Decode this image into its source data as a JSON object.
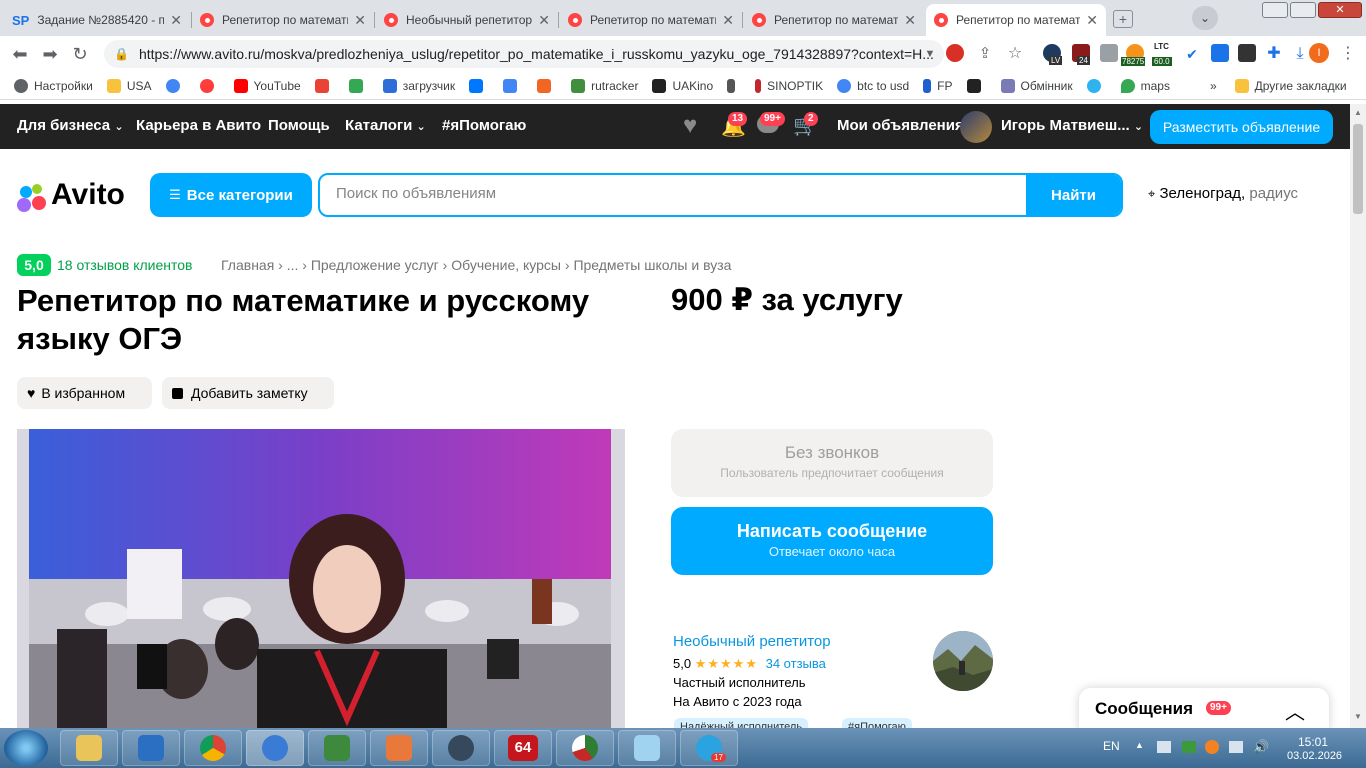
{
  "browser": {
    "tabs": [
      {
        "title": "Задание №2885420 - п",
        "favicon": "sp-icon"
      },
      {
        "title": "Репетитор по математи",
        "favicon": "avito-icon"
      },
      {
        "title": "Необычный репетитор",
        "favicon": "avito-icon"
      },
      {
        "title": "Репетитор по математи",
        "favicon": "avito-icon"
      },
      {
        "title": "Репетитор по математи",
        "favicon": "avito-icon"
      },
      {
        "title": "Репетитор по математи",
        "favicon": "avito-icon"
      }
    ],
    "sp_label": "SP",
    "url": "https://www.avito.ru/moskva/predlozheniya_uslug/repetitor_po_matematike_i_russkomu_yazyku_oge_7914328897?context=H...",
    "extension_labels": {
      "lv": "LV",
      "n24": "24",
      "btc": "78275",
      "ltc_top": "LTC",
      "ltc": "60.0",
      "profile": "I"
    },
    "bookmarks": [
      {
        "label": "Настройки",
        "color": "#5f6368"
      },
      {
        "label": "USA",
        "color": "#f9c23c"
      },
      {
        "label": "",
        "color": "#4285f4"
      },
      {
        "label": "",
        "color": "#ff3d3d"
      },
      {
        "label": "YouTube",
        "color": "#ff0000"
      },
      {
        "label": "",
        "color": "#ea4335"
      },
      {
        "label": "",
        "color": "#34a853"
      },
      {
        "label": "загрузчик",
        "color": "#2f6ed8"
      },
      {
        "label": "",
        "color": "#0077ff"
      },
      {
        "label": "",
        "color": "#4285f4"
      },
      {
        "label": "",
        "color": "#f26522"
      },
      {
        "label": "rutracker",
        "color": "#3f8f3f"
      },
      {
        "label": "UAKino",
        "color": "#222222"
      },
      {
        "label": "",
        "color": "#555555"
      },
      {
        "label": "SINOPTIK",
        "color": "#c1272d"
      },
      {
        "label": "btc to usd",
        "color": "#4285f4"
      },
      {
        "label": "FP",
        "color": "#1f5fcf"
      },
      {
        "label": "",
        "color": "#222222"
      },
      {
        "label": "Обмінник",
        "color": "#7a7ab5"
      },
      {
        "label": "",
        "color": "#2db4f0"
      },
      {
        "label": "maps",
        "color": "#34a853"
      }
    ],
    "bookmarks_more": "»",
    "other_bookmarks": "Другие закладки"
  },
  "header": {
    "nav": [
      "Для бизнеса",
      "Карьера в Авито",
      "Помощь",
      "Каталоги",
      "#яПомогаю"
    ],
    "notif_badge": "13",
    "msg_badge": "99+",
    "cart_badge": "2",
    "my_ads": "Мои объявления",
    "user_name": "Игорь Матвиеш...",
    "post_button": "Разместить объявление"
  },
  "search": {
    "logo_text": "Avito",
    "all_categories": "Все категории",
    "placeholder": "Поиск по объявлениям",
    "find_button": "Найти",
    "location_city": "Зеленоград,",
    "location_radius": "радиус"
  },
  "listing": {
    "rating": "5,0",
    "reviews": "18 отзывов клиентов",
    "breadcrumb": "Главная › ... › Предложение услуг › Обучение, курсы › Предметы школы и вуза",
    "title": "Репетитор по математике и русскому языку ОГЭ",
    "price": "900 ₽ за услугу",
    "favorite": "В избранном",
    "add_note": "Добавить заметку"
  },
  "contact": {
    "no_calls_title": "Без звонков",
    "no_calls_sub": "Пользователь предпочитает сообщения",
    "write_title": "Написать сообщение",
    "write_sub": "Отвечает около часа"
  },
  "seller": {
    "name": "Необычный репетитор",
    "rating": "5,0",
    "stars": "★★★★★",
    "reviews": "34 отзыва",
    "type": "Частный исполнитель",
    "since": "На Авито с 2023 года",
    "tags": [
      "Надёжный исполнитель",
      "#яПомогаю"
    ]
  },
  "messages": {
    "label": "Сообщения",
    "badge": "99+"
  },
  "taskbar": {
    "lang": "EN",
    "time": "15:01",
    "date": "03.02.2026",
    "badge_64": "64",
    "telegram_count": "17"
  },
  "colors": {
    "accent": "#00aaff",
    "header_bg": "#222222",
    "rating_green": "#02d15c",
    "badge_red": "#ff4053"
  }
}
